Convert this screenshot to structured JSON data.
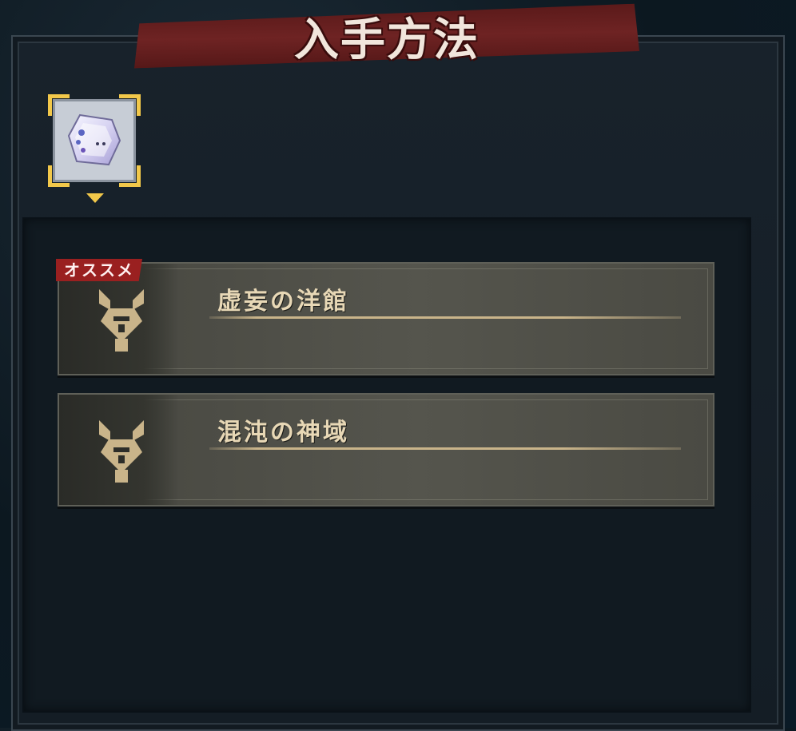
{
  "title": "入手方法",
  "item_slot": {
    "icon": "crystal-fragment-icon",
    "selected": true
  },
  "sources": [
    {
      "title": "虚妄の洋館",
      "badge": "オススメ",
      "icon": "demon-crest-icon"
    },
    {
      "title": "混沌の神域",
      "badge": "",
      "icon": "demon-crest-icon"
    }
  ],
  "colors": {
    "banner": "#6e2323",
    "accent_gold": "#f2c84a",
    "card_text": "#e8d8b6",
    "badge": "#9a2020"
  }
}
